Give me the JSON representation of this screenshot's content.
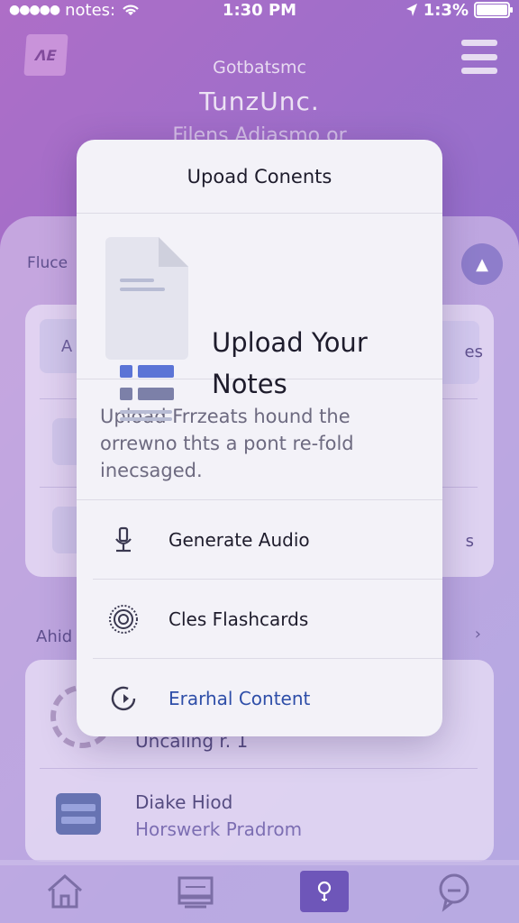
{
  "status_bar": {
    "carrier": "notes:",
    "time": "1:30 PM",
    "battery_percent": "1:3%"
  },
  "background": {
    "logo_text": "ΛΕ",
    "subtitle": "Gotbatsmc",
    "title": "TunzUnc.",
    "caption": "Filens Adiasmo or",
    "section_label": "Fluce",
    "row1_left": "A",
    "row1_right": "es",
    "row3_right": "s",
    "section_label_2": "Ahid",
    "cell1_title": "Uncaling r. 1",
    "cell2_title": "Diake Hiod",
    "cell2_sub": "Horswerk Pradrom"
  },
  "modal": {
    "header_title": "Upoad Conents",
    "hero_title": "Upload Your Notes",
    "description": "Upload Frrzeats hound the orrewno thts a pont re-fold inecsaged.",
    "options": [
      {
        "label": "Generate Audio",
        "icon": "microphone-icon"
      },
      {
        "label": "Cles Flashcards",
        "icon": "flashcards-icon"
      },
      {
        "label": "Erarhal Content",
        "icon": "content-icon"
      }
    ]
  },
  "tab_bar": {
    "tabs": [
      {
        "name": "home",
        "icon": "home-icon",
        "active": false
      },
      {
        "name": "library",
        "icon": "library-icon",
        "active": false
      },
      {
        "name": "ideas",
        "icon": "lightbulb-icon",
        "active": true
      },
      {
        "name": "chat",
        "icon": "chat-icon",
        "active": false
      }
    ]
  },
  "colors": {
    "gradient_start": "#a35ac0",
    "gradient_end": "#6f60c8",
    "modal_bg": "#f3f2f8",
    "accent_blue": "#2e4ea8",
    "active_tab": "#5a3fb0"
  }
}
